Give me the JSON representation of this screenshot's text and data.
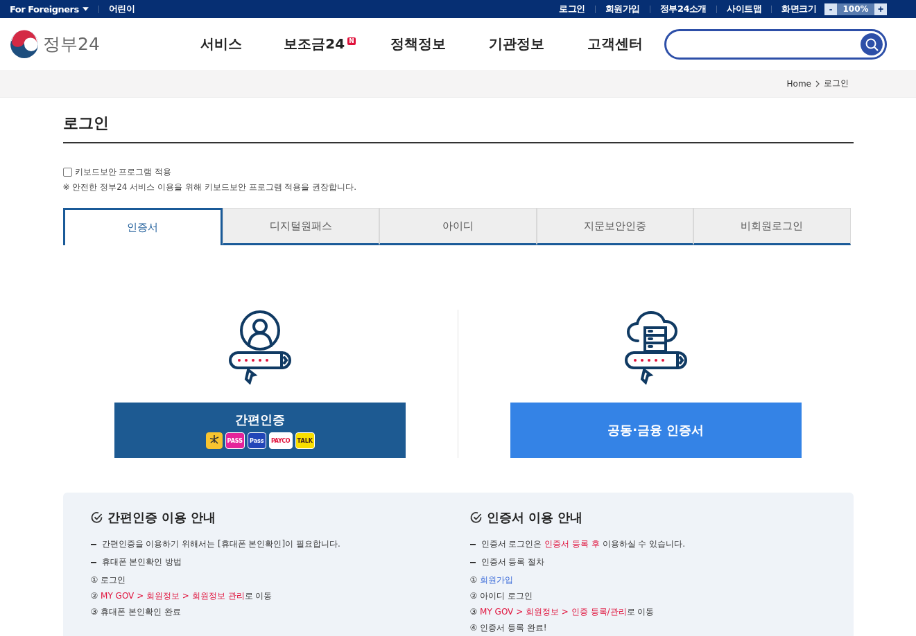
{
  "top_bar": {
    "left": [
      {
        "label": "For Foreigners",
        "dropdown": true
      },
      {
        "label": "어린이",
        "dropdown": false
      }
    ],
    "right": [
      "로그인",
      "회원가입",
      "정부24소개",
      "사이트맵"
    ],
    "zoom": {
      "label": "화면크기",
      "minus": "-",
      "value": "100%",
      "plus": "+"
    }
  },
  "header": {
    "logo": "정부24",
    "nav": [
      {
        "label": "서비스"
      },
      {
        "label": "보조금24",
        "badge": "N"
      },
      {
        "label": "정책정보"
      },
      {
        "label": "기관정보"
      },
      {
        "label": "고객센터"
      }
    ]
  },
  "breadcrumb": [
    "Home",
    "로그인"
  ],
  "page_title": "로그인",
  "keyboard_security": {
    "label": "키보드보안 프로그램 적용",
    "checked": false,
    "note": "※ 안전한 정부24 서비스 이용을 위해 키보드보안 프로그램 적용을 권장합니다."
  },
  "tabs": [
    {
      "label": "인증서",
      "selected": true
    },
    {
      "label": "디지털원패스",
      "selected": false
    },
    {
      "label": "아이디",
      "selected": false
    },
    {
      "label": "지문보안인증",
      "selected": false
    },
    {
      "label": "비회원로그인",
      "selected": false
    }
  ],
  "login_options": [
    {
      "kind": "simple",
      "label": "간편인증",
      "badges": [
        {
          "kind": "kb"
        },
        {
          "kind": "pass",
          "label": "PASS"
        },
        {
          "kind": "samsung",
          "label": "Pass"
        },
        {
          "kind": "payco",
          "label": "PAYCO"
        },
        {
          "kind": "talk",
          "label": "TALK"
        }
      ]
    },
    {
      "kind": "certificate",
      "label": "공동·금융 인증서"
    }
  ],
  "guides": [
    {
      "title": "간편인증 이용 안내",
      "lines": [
        {
          "kind": "dash",
          "parts": [
            {
              "kind": "plain",
              "text": "간편인증을 이용하기 위해서는 [휴대폰 본인확인]이 필요합니다."
            }
          ]
        },
        {
          "kind": "dash",
          "parts": [
            {
              "kind": "plain",
              "text": "휴대폰 본인확인 방법"
            }
          ]
        },
        {
          "kind": "step",
          "parts": [
            {
              "kind": "plain",
              "text": "① 로그인"
            }
          ]
        },
        {
          "kind": "step",
          "parts": [
            {
              "kind": "plain",
              "text": "② "
            },
            {
              "kind": "red",
              "text": "MY GOV > 회원정보 > 회원정보 관리"
            },
            {
              "kind": "plain",
              "text": "로 이동"
            }
          ]
        },
        {
          "kind": "step",
          "parts": [
            {
              "kind": "plain",
              "text": "③ 휴대폰 본인확인 완료"
            }
          ]
        }
      ]
    },
    {
      "title": "인증서 이용 안내",
      "lines": [
        {
          "kind": "dash",
          "parts": [
            {
              "kind": "plain",
              "text": "인증서 로그인은 "
            },
            {
              "kind": "red",
              "text": "인증서 등록 후"
            },
            {
              "kind": "plain",
              "text": " 이용하실 수 있습니다."
            }
          ]
        },
        {
          "kind": "dash",
          "parts": [
            {
              "kind": "plain",
              "text": "인증서 등록 절차"
            }
          ]
        },
        {
          "kind": "step",
          "parts": [
            {
              "kind": "plain",
              "text": "① "
            },
            {
              "kind": "link",
              "text": "회원가입"
            }
          ]
        },
        {
          "kind": "step",
          "parts": [
            {
              "kind": "plain",
              "text": "② 아이디 로그인"
            }
          ]
        },
        {
          "kind": "step",
          "parts": [
            {
              "kind": "plain",
              "text": "③ "
            },
            {
              "kind": "red",
              "text": "MY GOV > 회원정보 > 인증 등록/관리"
            },
            {
              "kind": "plain",
              "text": "로 이동"
            }
          ]
        },
        {
          "kind": "step",
          "parts": [
            {
              "kind": "plain",
              "text": "④ 인증서 등록 완료!"
            }
          ]
        }
      ]
    }
  ]
}
